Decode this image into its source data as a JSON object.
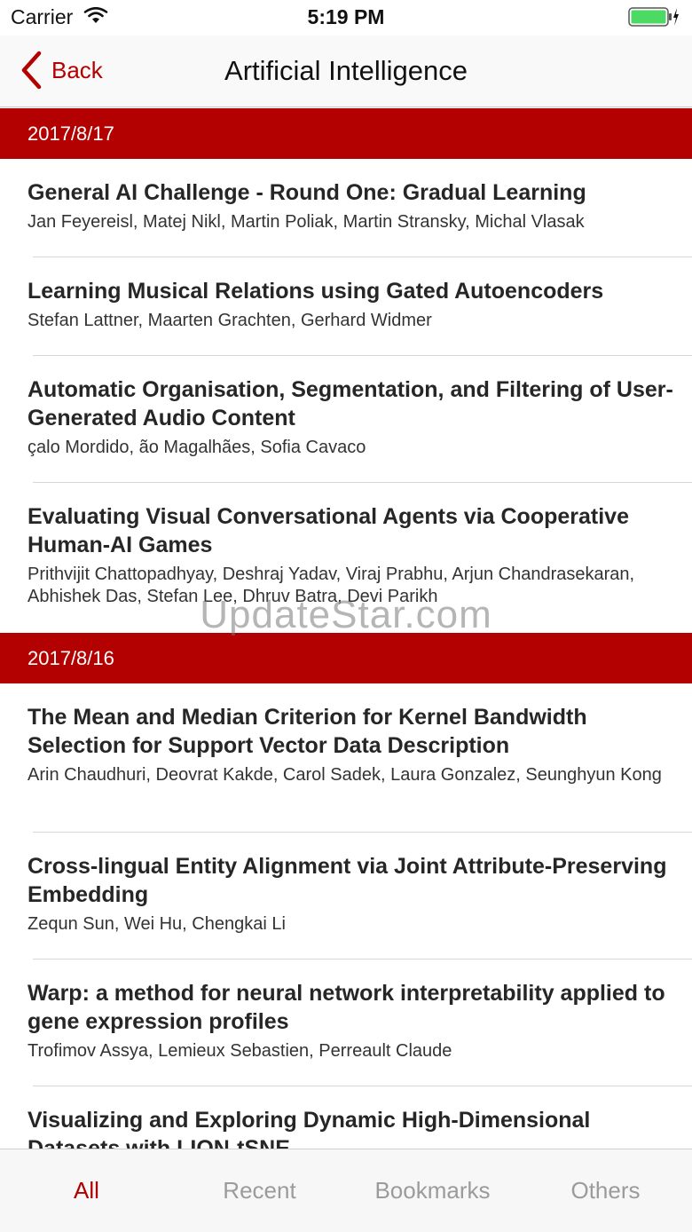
{
  "status_bar": {
    "carrier": "Carrier",
    "time": "5:19 PM"
  },
  "nav": {
    "back_label": "Back",
    "title": "Artificial Intelligence"
  },
  "sections": [
    {
      "date": "2017/8/17",
      "items": [
        {
          "title": "General AI Challenge - Round One: Gradual Learning",
          "authors": "Jan Feyereisl, Matej Nikl, Martin Poliak, Martin Stransky, Michal Vlasak"
        },
        {
          "title": "Learning Musical Relations using Gated Autoencoders",
          "authors": "Stefan Lattner, Maarten Grachten, Gerhard Widmer"
        },
        {
          "title": "Automatic Organisation, Segmentation, and Filtering of User-Generated   Audio Content",
          "authors": "çalo Mordido, ão Magalhães, Sofia Cavaco"
        },
        {
          "title": "Evaluating Visual Conversational Agents via Cooperative Human-AI Games",
          "authors": "Prithvijit Chattopadhyay, Deshraj Yadav, Viraj Prabhu, Arjun Chandrasekaran, Abhishek Das, Stefan Lee, Dhruv Batra, Devi Parikh"
        }
      ]
    },
    {
      "date": "2017/8/16",
      "items": [
        {
          "title": "The Mean and Median Criterion for Kernel Bandwidth Selection for Support   Vector Data Description",
          "authors": "Arin Chaudhuri, Deovrat Kakde, Carol Sadek, Laura Gonzalez, Seunghyun Kong"
        },
        {
          "title": "Cross-lingual Entity Alignment via Joint Attribute-Preserving Embedding",
          "authors": "Zequn Sun, Wei Hu, Chengkai Li"
        },
        {
          "title": "Warp: a method for neural network interpretability applied to gene   expression profiles",
          "authors": "Trofimov Assya, Lemieux Sebastien, Perreault Claude"
        },
        {
          "title": "Visualizing and Exploring Dynamic High-Dimensional Datasets with   LION-tSNE",
          "authors": ""
        }
      ]
    }
  ],
  "watermark": "UpdateStar.com",
  "tabs": {
    "all": "All",
    "recent": "Recent",
    "bookmarks": "Bookmarks",
    "others": "Others",
    "active": "All"
  },
  "colors": {
    "accent": "#b30000",
    "inactive_tab": "#9b9b9b",
    "battery": "#4cd964"
  },
  "icons": {
    "back": "chevron-left-icon",
    "wifi": "wifi-icon",
    "battery": "battery-icon",
    "charging": "bolt-icon"
  }
}
